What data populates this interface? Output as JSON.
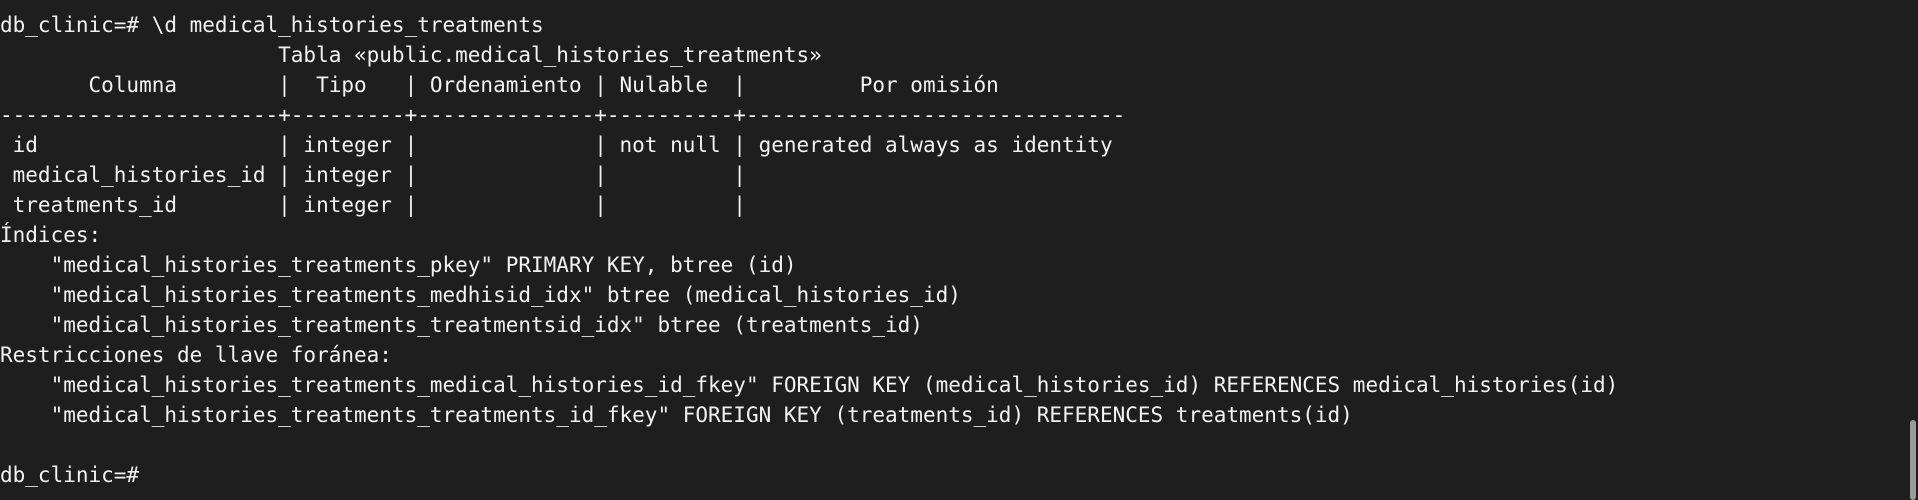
{
  "terminal": {
    "lines": [
      "db_clinic=# \\d medical_histories_treatments",
      "                      Tabla «public.medical_histories_treatments»",
      "       Columna        |  Tipo   | Ordenamiento | Nulable  |         Por omisión",
      "----------------------+---------+--------------+----------+------------------------------",
      " id                   | integer |              | not null | generated always as identity",
      " medical_histories_id | integer |              |          |",
      " treatments_id        | integer |              |          |",
      "Índices:",
      "    \"medical_histories_treatments_pkey\" PRIMARY KEY, btree (id)",
      "    \"medical_histories_treatments_medhisid_idx\" btree (medical_histories_id)",
      "    \"medical_histories_treatments_treatmentsid_idx\" btree (treatments_id)",
      "Restricciones de llave foránea:",
      "    \"medical_histories_treatments_medical_histories_id_fkey\" FOREIGN KEY (medical_histories_id) REFERENCES medical_histories(id)",
      "    \"medical_histories_treatments_treatments_id_fkey\" FOREIGN KEY (treatments_id) REFERENCES treatments(id)",
      "",
      "db_clinic=# "
    ]
  }
}
